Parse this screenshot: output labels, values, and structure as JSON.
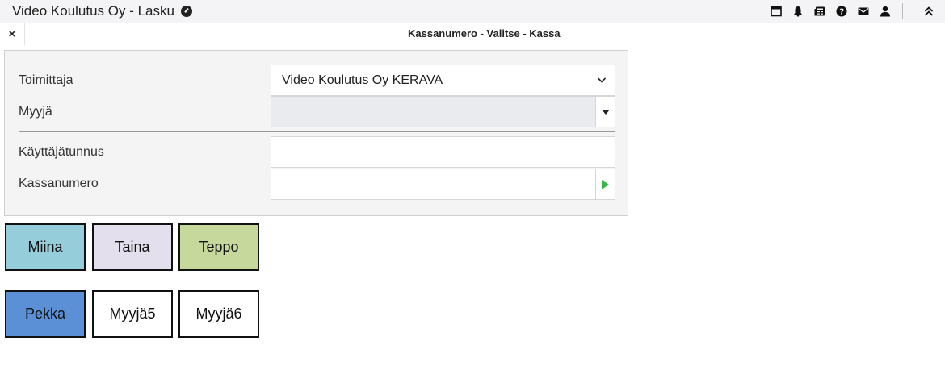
{
  "app": {
    "title": "Video Koulutus Oy - Lasku"
  },
  "topbar_icons": [
    "window-icon",
    "bell-icon",
    "news-icon",
    "help-icon",
    "mail-icon",
    "user-icon"
  ],
  "subbar": {
    "close_label": "×",
    "breadcrumb": "Kassanumero - Valitse - Kassa"
  },
  "form": {
    "supplier": {
      "label": "Toimittaja",
      "value": "Video Koulutus Oy KERAVA"
    },
    "seller": {
      "label": "Myyjä",
      "value": ""
    },
    "username": {
      "label": "Käyttäjätunnus",
      "value": ""
    },
    "register": {
      "label": "Kassanumero",
      "value": ""
    }
  },
  "sellers": [
    {
      "label": "Miina",
      "color": "#96cddb"
    },
    {
      "label": "Taina",
      "color": "#e3dfec"
    },
    {
      "label": "Teppo",
      "color": "#c6d89b"
    },
    {
      "label": "Pekka",
      "color": "#5b8fd6"
    },
    {
      "label": "Myyjä5",
      "color": "#ffffff"
    },
    {
      "label": "Myyjä6",
      "color": "#ffffff"
    }
  ],
  "colors": {
    "accent_green": "#3ab54a",
    "panel_bg": "#f4f4f4",
    "topbar_bg": "#f4f4f6"
  }
}
